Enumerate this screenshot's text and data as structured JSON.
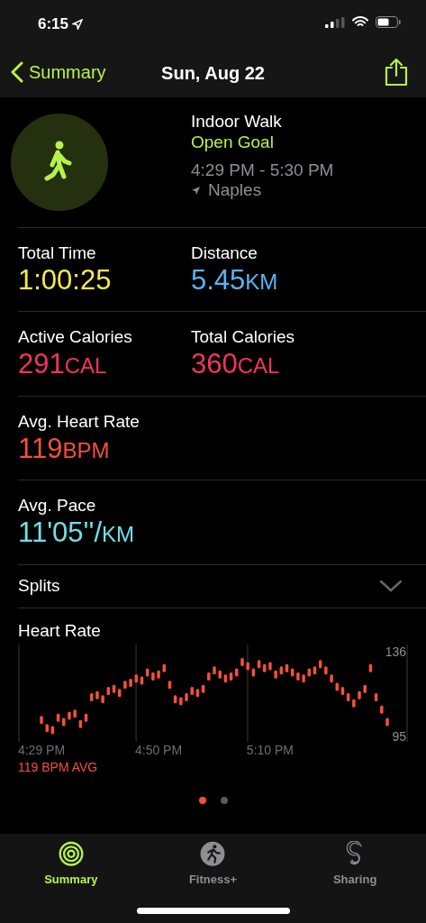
{
  "status_bar": {
    "time": "6:15"
  },
  "nav": {
    "back": "Summary",
    "title": "Sun, Aug 22"
  },
  "workout": {
    "name": "Indoor Walk",
    "goal": "Open Goal",
    "time_range": "4:29 PM - 5:30 PM",
    "location": "Naples"
  },
  "metric_rows": [
    [
      {
        "label": "Total Time",
        "value": "1:00:25",
        "color": "#f5e94a"
      },
      {
        "label": "Distance",
        "value": "5.45",
        "unit": "KM",
        "color": "#5ab4f5"
      }
    ],
    [
      {
        "label": "Active Calories",
        "value": "291",
        "unit": "CAL",
        "color": "#f5345a"
      },
      {
        "label": "Total Calories",
        "value": "360",
        "unit": "CAL",
        "color": "#f5345a"
      }
    ],
    [
      {
        "label": "Avg. Heart Rate",
        "value": "119",
        "unit": "BPM",
        "color": "#f5503a"
      }
    ],
    [
      {
        "label": "Avg. Pace",
        "value": "11'05''/",
        "unit": "KM",
        "color": "#6ee0e8"
      }
    ]
  ],
  "splits": {
    "label": "Splits",
    "expanded": false
  },
  "heart_rate": {
    "title": "Heart Rate",
    "average": "119 BPM AVG",
    "chart_data": {
      "type": "scatter",
      "categories": [
        "4:29 PM",
        null,
        null,
        null,
        null,
        null,
        null,
        null,
        null,
        null,
        null,
        null,
        null,
        null,
        null,
        null,
        null,
        null,
        null,
        null,
        null,
        "4:50 PM",
        null,
        null,
        null,
        null,
        null,
        null,
        null,
        null,
        null,
        null,
        null,
        null,
        null,
        null,
        null,
        null,
        null,
        null,
        null,
        "5:10 PM",
        null,
        null,
        null,
        null,
        null,
        null,
        null,
        null,
        null,
        null,
        null,
        null,
        null,
        null,
        null,
        null,
        null,
        null,
        null,
        null,
        null
      ],
      "series": [
        {
          "color": "#f5503a",
          "values": [
            103,
            99,
            98,
            104,
            102,
            105,
            106,
            101,
            104,
            114,
            115,
            113,
            117,
            118,
            116,
            120,
            121,
            123,
            122,
            126,
            124,
            125,
            128,
            120,
            113,
            112,
            114,
            117,
            116,
            118,
            124,
            127,
            125,
            123,
            124,
            126,
            131,
            129,
            126,
            130,
            128,
            129,
            125,
            127,
            128,
            126,
            124,
            123,
            126,
            127,
            130,
            127,
            123,
            119,
            117,
            114,
            111,
            115,
            118,
            128,
            114,
            108,
            102
          ]
        }
      ],
      "ylim": [
        95,
        136
      ],
      "yticks": [
        95,
        136
      ]
    }
  },
  "pages": [
    {
      "selected": true
    },
    {
      "selected": false
    }
  ],
  "tabs": [
    {
      "label": "Summary",
      "selected": true
    },
    {
      "label": "Fitness+",
      "selected": false
    },
    {
      "label": "Sharing",
      "selected": false
    }
  ]
}
